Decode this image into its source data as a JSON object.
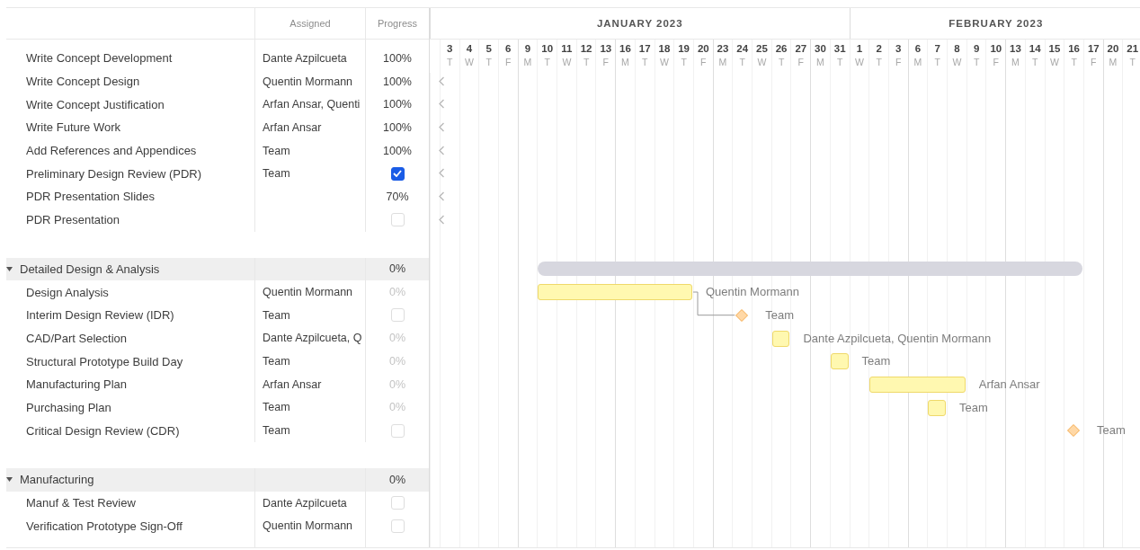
{
  "columns": {
    "assigned": "Assigned",
    "progress": "Progress"
  },
  "timeline": {
    "months": [
      {
        "label": "JANUARY 2023",
        "days": [
          {
            "day": "3",
            "weekday": "T",
            "week_start": false
          },
          {
            "day": "4",
            "weekday": "W",
            "week_start": false
          },
          {
            "day": "5",
            "weekday": "T",
            "week_start": false
          },
          {
            "day": "6",
            "weekday": "F",
            "week_start": false
          },
          {
            "day": "9",
            "weekday": "M",
            "week_start": true
          },
          {
            "day": "10",
            "weekday": "T",
            "week_start": false
          },
          {
            "day": "11",
            "weekday": "W",
            "week_start": false
          },
          {
            "day": "12",
            "weekday": "T",
            "week_start": false
          },
          {
            "day": "13",
            "weekday": "F",
            "week_start": false
          },
          {
            "day": "16",
            "weekday": "M",
            "week_start": true
          },
          {
            "day": "17",
            "weekday": "T",
            "week_start": false
          },
          {
            "day": "18",
            "weekday": "W",
            "week_start": false
          },
          {
            "day": "19",
            "weekday": "T",
            "week_start": false
          },
          {
            "day": "20",
            "weekday": "F",
            "week_start": false
          },
          {
            "day": "23",
            "weekday": "M",
            "week_start": true
          },
          {
            "day": "24",
            "weekday": "T",
            "week_start": false
          },
          {
            "day": "25",
            "weekday": "W",
            "week_start": false
          },
          {
            "day": "26",
            "weekday": "T",
            "week_start": false
          },
          {
            "day": "27",
            "weekday": "F",
            "week_start": false
          },
          {
            "day": "30",
            "weekday": "M",
            "week_start": true
          },
          {
            "day": "31",
            "weekday": "T",
            "week_start": false
          }
        ]
      },
      {
        "label": "FEBRUARY 2023",
        "days": [
          {
            "day": "1",
            "weekday": "W",
            "week_start": false
          },
          {
            "day": "2",
            "weekday": "T",
            "week_start": false
          },
          {
            "day": "3",
            "weekday": "F",
            "week_start": false
          },
          {
            "day": "6",
            "weekday": "M",
            "week_start": true
          },
          {
            "day": "7",
            "weekday": "T",
            "week_start": false
          },
          {
            "day": "8",
            "weekday": "W",
            "week_start": false
          },
          {
            "day": "9",
            "weekday": "T",
            "week_start": false
          },
          {
            "day": "10",
            "weekday": "F",
            "week_start": false
          },
          {
            "day": "13",
            "weekday": "M",
            "week_start": true
          },
          {
            "day": "14",
            "weekday": "T",
            "week_start": false
          },
          {
            "day": "15",
            "weekday": "W",
            "week_start": false
          },
          {
            "day": "16",
            "weekday": "T",
            "week_start": false
          },
          {
            "day": "17",
            "weekday": "F",
            "week_start": false
          },
          {
            "day": "20",
            "weekday": "M",
            "week_start": true
          },
          {
            "day": "21",
            "weekday": "T",
            "week_start": false
          }
        ]
      }
    ]
  },
  "rows": [
    {
      "kind": "task",
      "name": "Write Concept Development",
      "assigned": "Dante Azpilcueta",
      "progress": {
        "kind": "percent",
        "text": "100%",
        "muted": false
      },
      "earlier": false
    },
    {
      "kind": "task",
      "name": "Write Concept Design",
      "assigned": "Quentin Mormann",
      "progress": {
        "kind": "percent",
        "text": "100%",
        "muted": false
      },
      "earlier": true
    },
    {
      "kind": "task",
      "name": "Write Concept Justification",
      "assigned": "Arfan Ansar, Quenti",
      "progress": {
        "kind": "percent",
        "text": "100%",
        "muted": false
      },
      "earlier": true
    },
    {
      "kind": "task",
      "name": "Write Future Work",
      "assigned": "Arfan Ansar",
      "progress": {
        "kind": "percent",
        "text": "100%",
        "muted": false
      },
      "earlier": true
    },
    {
      "kind": "task",
      "name": "Add References and Appendices",
      "assigned": "Team",
      "progress": {
        "kind": "percent",
        "text": "100%",
        "muted": false
      },
      "earlier": true
    },
    {
      "kind": "task",
      "name": "Preliminary Design Review (PDR)",
      "assigned": "Team",
      "progress": {
        "kind": "checkbox",
        "checked": true
      },
      "earlier": true
    },
    {
      "kind": "task",
      "name": "PDR Presentation Slides",
      "progress": {
        "kind": "percent",
        "text": "70%",
        "muted": false
      },
      "earlier": true
    },
    {
      "kind": "task",
      "name": "PDR Presentation",
      "progress": {
        "kind": "checkbox",
        "checked": false
      },
      "earlier": true
    },
    {
      "kind": "group",
      "name": "Detailed Design & Analysis",
      "expanded": true,
      "progress": {
        "kind": "percent",
        "text": "0%",
        "muted": false
      },
      "bar": {
        "kind": "summary"
      },
      "children": [
        {
          "kind": "task",
          "name": "Design Analysis",
          "assigned": "Quentin Mormann",
          "progress": {
            "kind": "percent",
            "text": "0%",
            "muted": true
          },
          "bar": {
            "kind": "task",
            "label": "Quentin Mormann"
          }
        },
        {
          "kind": "task",
          "name": "Interim Design Review (IDR)",
          "assigned": "Team",
          "progress": {
            "kind": "checkbox",
            "checked": false
          },
          "bar": {
            "kind": "milestone",
            "label": "Team",
            "linked_from_previous": true
          }
        },
        {
          "kind": "task",
          "name": "CAD/Part Selection",
          "assigned": "Dante Azpilcueta, Q",
          "progress": {
            "kind": "percent",
            "text": "0%",
            "muted": true
          },
          "bar": {
            "kind": "task",
            "label": "Dante Azpilcueta, Quentin Mormann"
          }
        },
        {
          "kind": "task",
          "name": "Structural Prototype Build Day",
          "assigned": "Team",
          "progress": {
            "kind": "percent",
            "text": "0%",
            "muted": true
          },
          "bar": {
            "kind": "task",
            "label": "Team"
          }
        },
        {
          "kind": "task",
          "name": "Manufacturing Plan",
          "assigned": "Arfan Ansar",
          "progress": {
            "kind": "percent",
            "text": "0%",
            "muted": true
          },
          "bar": {
            "kind": "task",
            "label": "Arfan Ansar"
          }
        },
        {
          "kind": "task",
          "name": "Purchasing Plan",
          "assigned": "Team",
          "progress": {
            "kind": "percent",
            "text": "0%",
            "muted": true
          },
          "bar": {
            "kind": "task",
            "label": "Team"
          }
        },
        {
          "kind": "task",
          "name": "Critical Design Review (CDR)",
          "assigned": "Team",
          "progress": {
            "kind": "checkbox",
            "checked": false
          },
          "bar": {
            "kind": "milestone",
            "label": "Team"
          }
        }
      ]
    },
    {
      "kind": "group",
      "name": "Manufacturing",
      "expanded": true,
      "progress": {
        "kind": "percent",
        "text": "0%",
        "muted": false
      },
      "children": [
        {
          "kind": "task",
          "name": "Manuf & Test Review",
          "assigned": "Dante Azpilcueta",
          "progress": {
            "kind": "checkbox",
            "checked": false
          }
        },
        {
          "kind": "task",
          "name": "Verification Prototype Sign-Off",
          "assigned": "Quentin Mormann",
          "progress": {
            "kind": "checkbox",
            "checked": false
          }
        }
      ]
    }
  ]
}
